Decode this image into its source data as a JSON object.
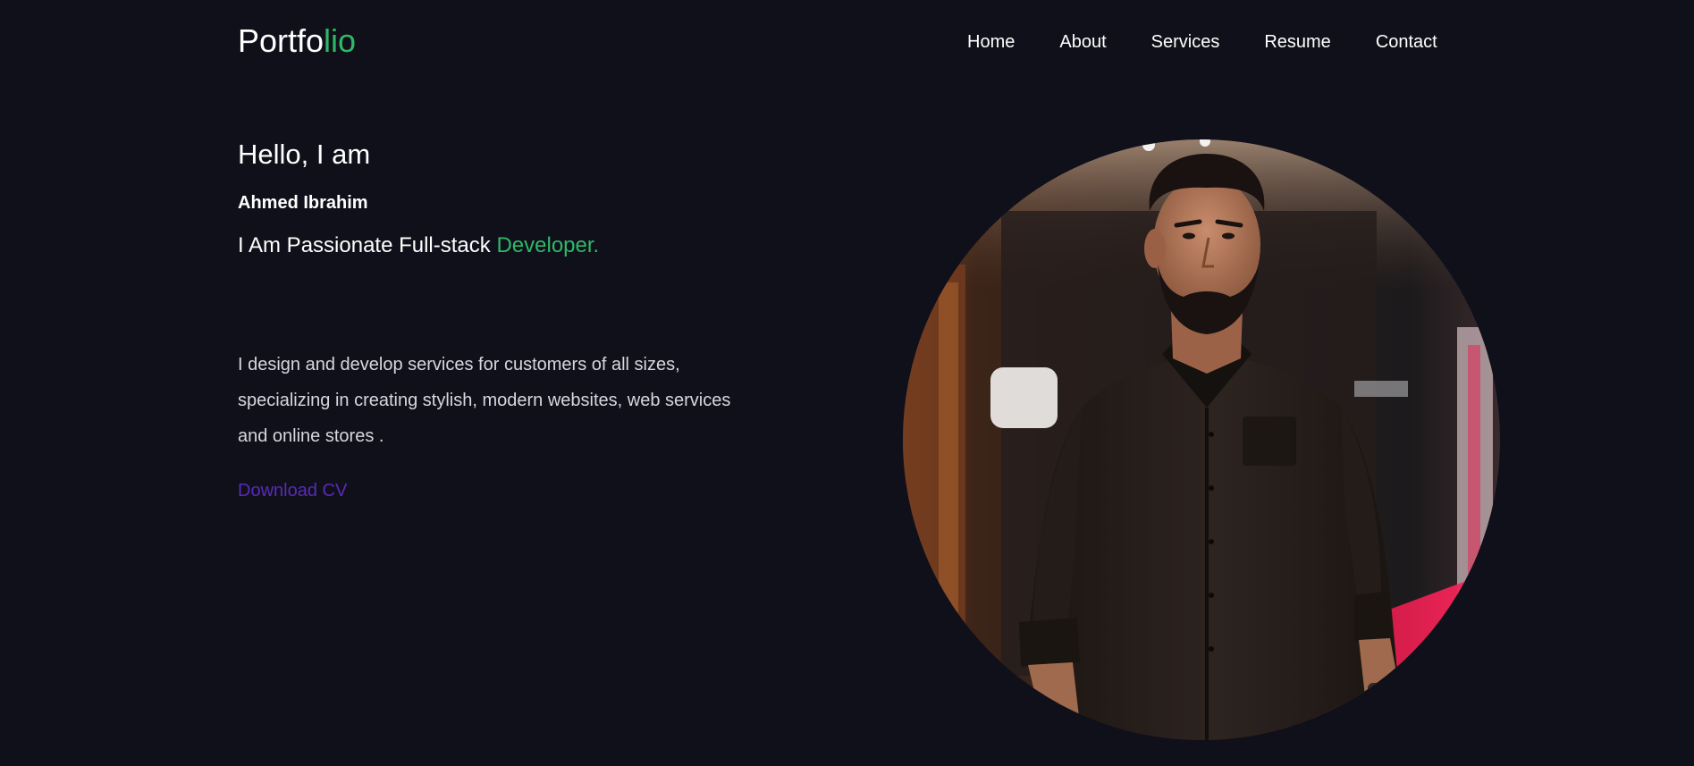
{
  "header": {
    "logo_main": "Portfo",
    "logo_accent": "lio",
    "nav": {
      "home": "Home",
      "about": "About",
      "services": "Services",
      "resume": "Resume",
      "contact": "Contact"
    }
  },
  "hero": {
    "greeting": "Hello, I am",
    "name": "Ahmed Ibrahim",
    "tagline_main": "I Am Passionate Full-stack ",
    "tagline_accent": "Developer.",
    "description": "I design and develop services for customers of all sizes, specializing in creating stylish, modern websites, web services and online stores .",
    "cv_label": "Download CV"
  },
  "portrait": {
    "alt": "profile photo"
  },
  "colors": {
    "background": "#10101a",
    "accent_green": "#2fb868",
    "link_purple": "#5a2ab8"
  }
}
